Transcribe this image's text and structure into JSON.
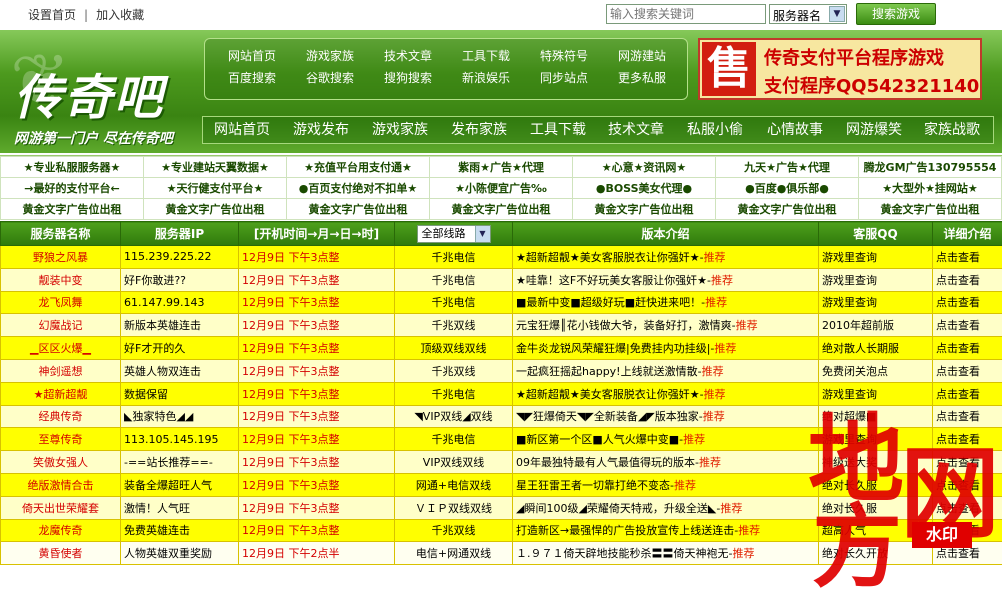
{
  "topbar": {
    "home": "设置首页",
    "fav": "加入收藏",
    "sep": "|",
    "search_placeholder": "输入搜索关键词",
    "select_value": "服务器名",
    "search_btn": "搜索游戏"
  },
  "logo": {
    "main": "传奇吧",
    "slogan": "网游第一门户  尽在传奇吧"
  },
  "quicklinks": [
    [
      "网站首页",
      "游戏家族",
      "技术文章",
      "工具下载",
      "特殊符号",
      "网游建站"
    ],
    [
      "百度搜索",
      "谷歌搜索",
      "搜狗搜索",
      "新浪娱乐",
      "同步站点",
      "更多私服"
    ]
  ],
  "ad": {
    "char": "售",
    "line1": "传奇支付平台程序游戏",
    "line2": "支付程序QQ542321140"
  },
  "mainnav": [
    "网站首页",
    "游戏发布",
    "游戏家族",
    "发布家族",
    "工具下载",
    "技术文章",
    "私服小偷",
    "心情故事",
    "网游爆笑",
    "家族战歌"
  ],
  "textads": [
    [
      "★专业私服服务器★",
      "★专业建站天翼数据★",
      "★充值平台用支付通★",
      "紫雨★广告★代理",
      "★心意★资讯网★",
      "九天★广告★代理",
      "腾龙GM广告130795554"
    ],
    [
      "→最好的支付平台←",
      "★天行健支付平台★",
      "●百页支付绝对不扣单★",
      "★小陈便宜广告‰",
      "●BOSS美女代理●",
      "●百度●俱乐部●",
      "★大型外★挂网站★"
    ],
    [
      "黄金文字广告位出租",
      "黄金文字广告位出租",
      "黄金文字广告位出租",
      "黄金文字广告位出租",
      "黄金文字广告位出租",
      "黄金文字广告位出租",
      "黄金文字广告位出租"
    ]
  ],
  "listing": {
    "headers": {
      "name": "服务器名称",
      "ip": "服务器IP",
      "time": "[开机时间→月→日→时]",
      "line": "全部线路",
      "intro": "版本介绍",
      "qq": "客服QQ",
      "more": "详细介绍"
    },
    "rows": [
      {
        "name": "野狼之风暴",
        "ip": "115.239.225.22",
        "time": "12月9日  下午3点整",
        "line": "千兆电信",
        "intro": "★超新超靓★美女客服脱衣让你强奸★-",
        "tj": "推荐",
        "qq": "游戏里查询",
        "more": "点击查看"
      },
      {
        "name": "靓装中变",
        "ip": "好F你敢进??",
        "time": "12月9日  下午3点整",
        "line": "千兆电信",
        "intro": "★哇靠！这F不好玩美女客服让你强奸★-",
        "tj": "推荐",
        "qq": "游戏里查询",
        "more": "点击查看"
      },
      {
        "name": "龙飞凤舞",
        "ip": "61.147.99.143",
        "time": "12月9日  下午3点整",
        "line": "千兆电信",
        "intro": "■最新中变■超级好玩■赶快进来吧！-",
        "tj": "推荐",
        "qq": "游戏里查询",
        "more": "点击查看"
      },
      {
        "name": "幻魔战记",
        "ip": "新版本英雄连击",
        "time": "12月9日  下午3点整",
        "line": "千兆双线",
        "intro": "元宝狂爆║花小钱做大爷，装备好打，激情爽-",
        "tj": "推荐",
        "qq": "2010年超前版",
        "more": "点击查看"
      },
      {
        "name": "▁区区火爆▁",
        "ip": "好F才开的久",
        "time": "12月9日  下午3点整",
        "line": "顶级双线双线",
        "intro": "金牛炎龙锐风荣耀狂爆|免费挂内功挂级|-",
        "tj": "推荐",
        "qq": "绝对散人长期服",
        "more": "点击查看"
      },
      {
        "name": "神剑遥想",
        "ip": "英雄人物双连击",
        "time": "12月9日  下午3点整",
        "line": "千兆双线",
        "intro": "一起疯狂摇起happy!上线就送激情散-",
        "tj": "推荐",
        "qq": "免费闭关泡点",
        "more": "点击查看"
      },
      {
        "name": "★超新超靓",
        "ip": "数据保留",
        "time": "12月9日  下午3点整",
        "line": "千兆电信",
        "intro": "★超新超靓★美女客服脱衣让你强奸★-",
        "tj": "推荐",
        "qq": "游戏里查询",
        "more": "点击查看"
      },
      {
        "name": "经典传奇",
        "ip": "◣独家特色◢◢",
        "time": "12月9日  下午3点整",
        "line": "◥VIP双线◢双线",
        "intro": "◥◤狂爆倚天◥◤全新装备◢◤版本独家-",
        "tj": "推荐",
        "qq": "绝对超爆■",
        "more": "点击查看"
      },
      {
        "name": "至尊传奇",
        "ip": "113.105.145.195",
        "time": "12月9日  下午3点整",
        "line": "千兆电信",
        "intro": "■新区第一个区■人气火爆中变■-",
        "tj": "推荐",
        "qq": "游戏里查询",
        "more": "点击查看"
      },
      {
        "name": "笑傲女强人",
        "ip": "-==站长推荐==-",
        "time": "12月9日  下午3点整",
        "line": "VIP双线双线",
        "intro": "09年最独特最有人气最值得玩的版本-",
        "tj": "推荐",
        "qq": "神级送大奖",
        "more": "点击查看"
      },
      {
        "name": "绝版激情合击",
        "ip": "装备全爆超旺人气",
        "time": "12月9日  下午3点整",
        "line": "网通+电信双线",
        "intro": "星王狂雷王者一切靠打绝不变态-",
        "tj": "推荐",
        "qq": "绝对长久服",
        "more": "点击查看"
      },
      {
        "name": "倚天出世荣耀套",
        "ip": "激情！人气旺",
        "time": "12月9日  下午3点整",
        "line": "ＶＩＰ双线双线",
        "intro": "◢瞬间100级◢荣耀倚天特戒，升级全送◣-",
        "tj": "推荐",
        "qq": "绝对长久服",
        "more": "点击查看"
      },
      {
        "name": "龙魔传奇",
        "ip": "免费英雄连击",
        "time": "12月9日  下午3点整",
        "line": "千兆双线",
        "intro": "打造新区→最强悍的广告投放宣传上线送连击-",
        "tj": "推荐",
        "qq": "超高人气",
        "more": "点击查看"
      },
      {
        "name": "黄昏使者",
        "ip": "人物英雄双重奖励",
        "time": "12月9日  下午2点半",
        "line": "电信+网通双线",
        "intro": "１.９７１倚天辟地技能秒杀〓〓倚天神袍无-",
        "tj": "推荐",
        "qq": "绝对长久开放",
        "more": "点击查看"
      }
    ]
  },
  "watermark": {
    "c1": "地",
    "c2": "网",
    "c3": "方",
    "tag": "水印"
  }
}
